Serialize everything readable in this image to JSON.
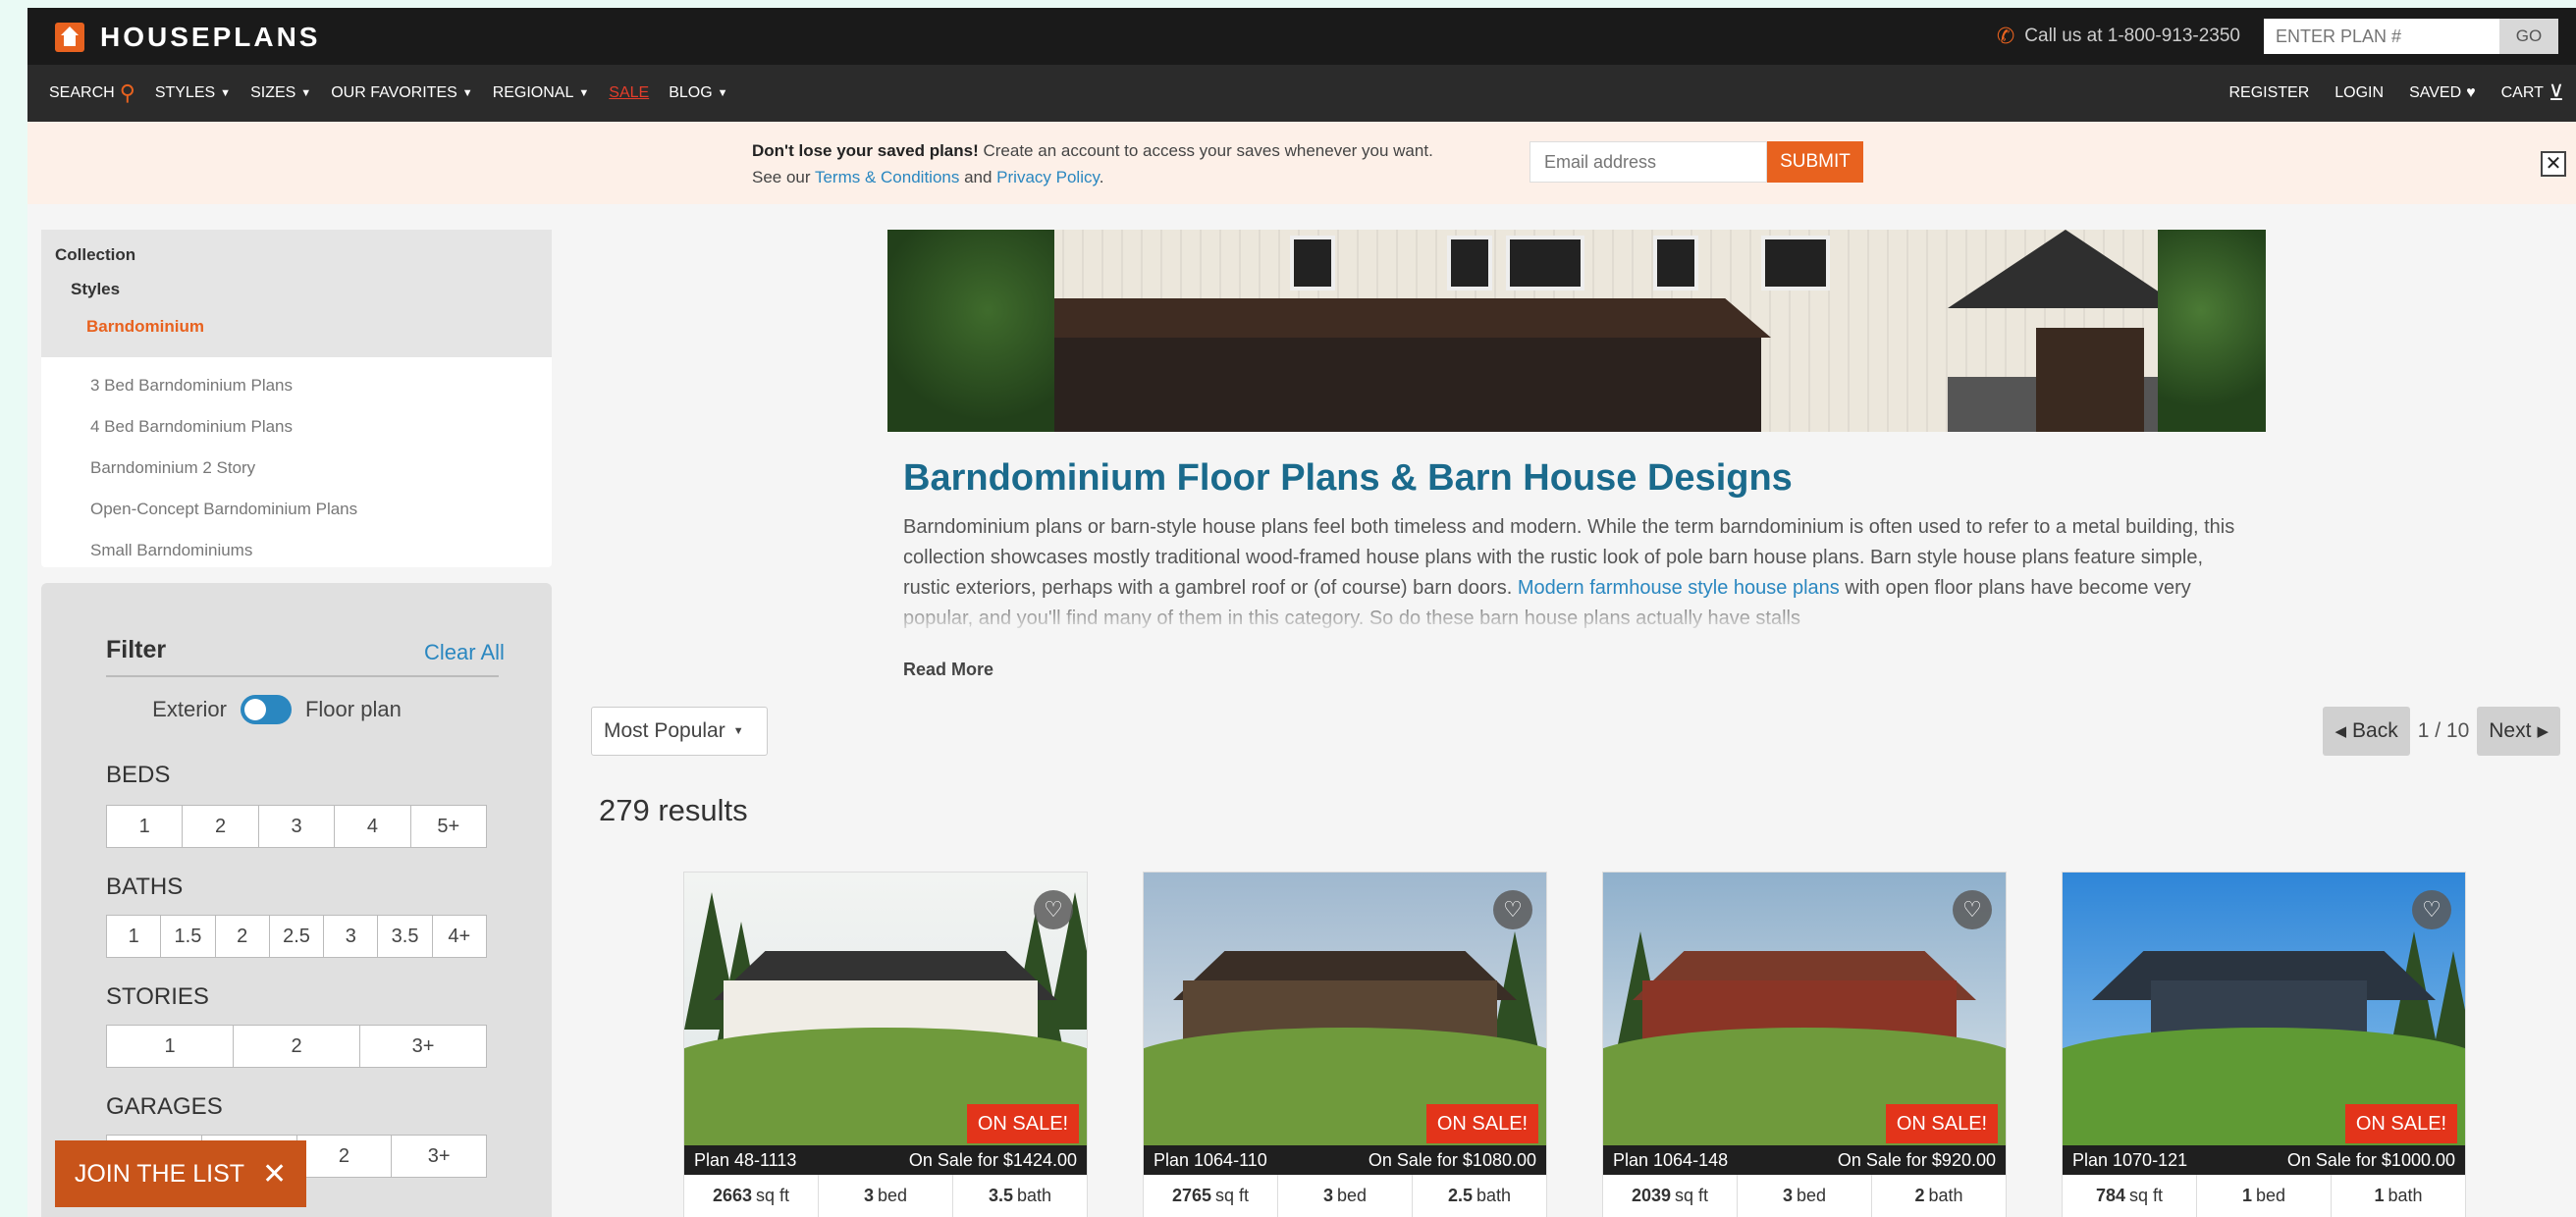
{
  "brand": {
    "name": "HOUSEPLANS"
  },
  "topbar": {
    "phone_text": "Call us at 1-800-913-2350",
    "plan_placeholder": "ENTER PLAN #",
    "go_label": "GO"
  },
  "nav": {
    "left": [
      {
        "label": "SEARCH",
        "icon": "search-icon"
      },
      {
        "label": "STYLES",
        "dropdown": true
      },
      {
        "label": "SIZES",
        "dropdown": true
      },
      {
        "label": "OUR FAVORITES",
        "dropdown": true
      },
      {
        "label": "REGIONAL",
        "dropdown": true
      },
      {
        "label": "SALE"
      },
      {
        "label": "BLOG",
        "dropdown": true
      }
    ],
    "right": [
      {
        "label": "REGISTER"
      },
      {
        "label": "LOGIN"
      },
      {
        "label": "SAVED",
        "icon": "heart-icon"
      },
      {
        "label": "CART",
        "icon": "cart-icon"
      }
    ]
  },
  "banner": {
    "bold": "Don't lose your saved plans!",
    "text1": " Create an account to access your saves whenever you want. See our ",
    "terms": "Terms & Conditions",
    "and": " and ",
    "privacy": "Privacy Policy",
    "end": ".",
    "email_placeholder": "Email address",
    "submit_label": "SUBMIT"
  },
  "sidebar": {
    "collection_label": "Collection",
    "styles_label": "Styles",
    "current_label": "Barndominium",
    "subitems": [
      "3 Bed Barndominium Plans",
      "4 Bed Barndominium Plans",
      "Barndominium 2 Story",
      "Open-Concept Barndominium Plans",
      "Small Barndominiums"
    ],
    "filter": {
      "title": "Filter",
      "clear_all": "Clear All",
      "toggle_left": "Exterior",
      "toggle_right": "Floor plan",
      "beds_label": "BEDS",
      "beds": [
        "1",
        "2",
        "3",
        "4",
        "5+"
      ],
      "baths_label": "BATHS",
      "baths": [
        "1",
        "1.5",
        "2",
        "2.5",
        "3",
        "3.5",
        "4+"
      ],
      "stories_label": "STORIES",
      "stories": [
        "1",
        "2",
        "3+"
      ],
      "garages_label": "GARAGES",
      "garages": [
        "",
        "",
        "2",
        "3+"
      ]
    },
    "join_label": "JOIN THE LIST"
  },
  "main": {
    "title": "Barndominium Floor Plans & Barn House Designs",
    "desc_1": "Barndominium plans or barn-style house plans feel both timeless and modern. While the term barndominium is often used to refer to a metal building, this collection showcases mostly traditional wood-framed house plans with the rustic look of pole barn house plans. Barn style house plans feature simple, rustic exteriors, perhaps with a gambrel roof or (of course) barn doors. ",
    "desc_link": "Modern farmhouse style house plans",
    "desc_2": " with open floor plans have become very popular, and you'll find many of them in this category. So do these barn house plans actually have stalls",
    "read_more": "Read More",
    "sort_value": "Most Popular",
    "pager": {
      "back": "Back",
      "page_text": "1 / 10",
      "next": "Next"
    },
    "results_text": "279 results"
  },
  "cards": [
    {
      "plan": "Plan 48-1113",
      "sale": "On Sale for $1424.00",
      "badge": "ON SALE!",
      "sqft": "2663",
      "sqft_unit": "sq ft",
      "bed": "3",
      "bed_unit": "bed",
      "bath": "3.5",
      "bath_unit": "bath"
    },
    {
      "plan": "Plan 1064-110",
      "sale": "On Sale for $1080.00",
      "badge": "ON SALE!",
      "sqft": "2765",
      "sqft_unit": "sq ft",
      "bed": "3",
      "bed_unit": "bed",
      "bath": "2.5",
      "bath_unit": "bath"
    },
    {
      "plan": "Plan 1064-148",
      "sale": "On Sale for $920.00",
      "badge": "ON SALE!",
      "sqft": "2039",
      "sqft_unit": "sq ft",
      "bed": "3",
      "bed_unit": "bed",
      "bath": "2",
      "bath_unit": "bath"
    },
    {
      "plan": "Plan 1070-121",
      "sale": "On Sale for $1000.00",
      "badge": "ON SALE!",
      "sqft": "784",
      "sqft_unit": "sq ft",
      "bed": "1",
      "bed_unit": "bed",
      "bath": "1",
      "bath_unit": "bath"
    }
  ],
  "colors": {
    "accent": "#e8621f",
    "link": "#2a87c0",
    "title": "#1a6a8c",
    "sale": "#e3341a"
  }
}
